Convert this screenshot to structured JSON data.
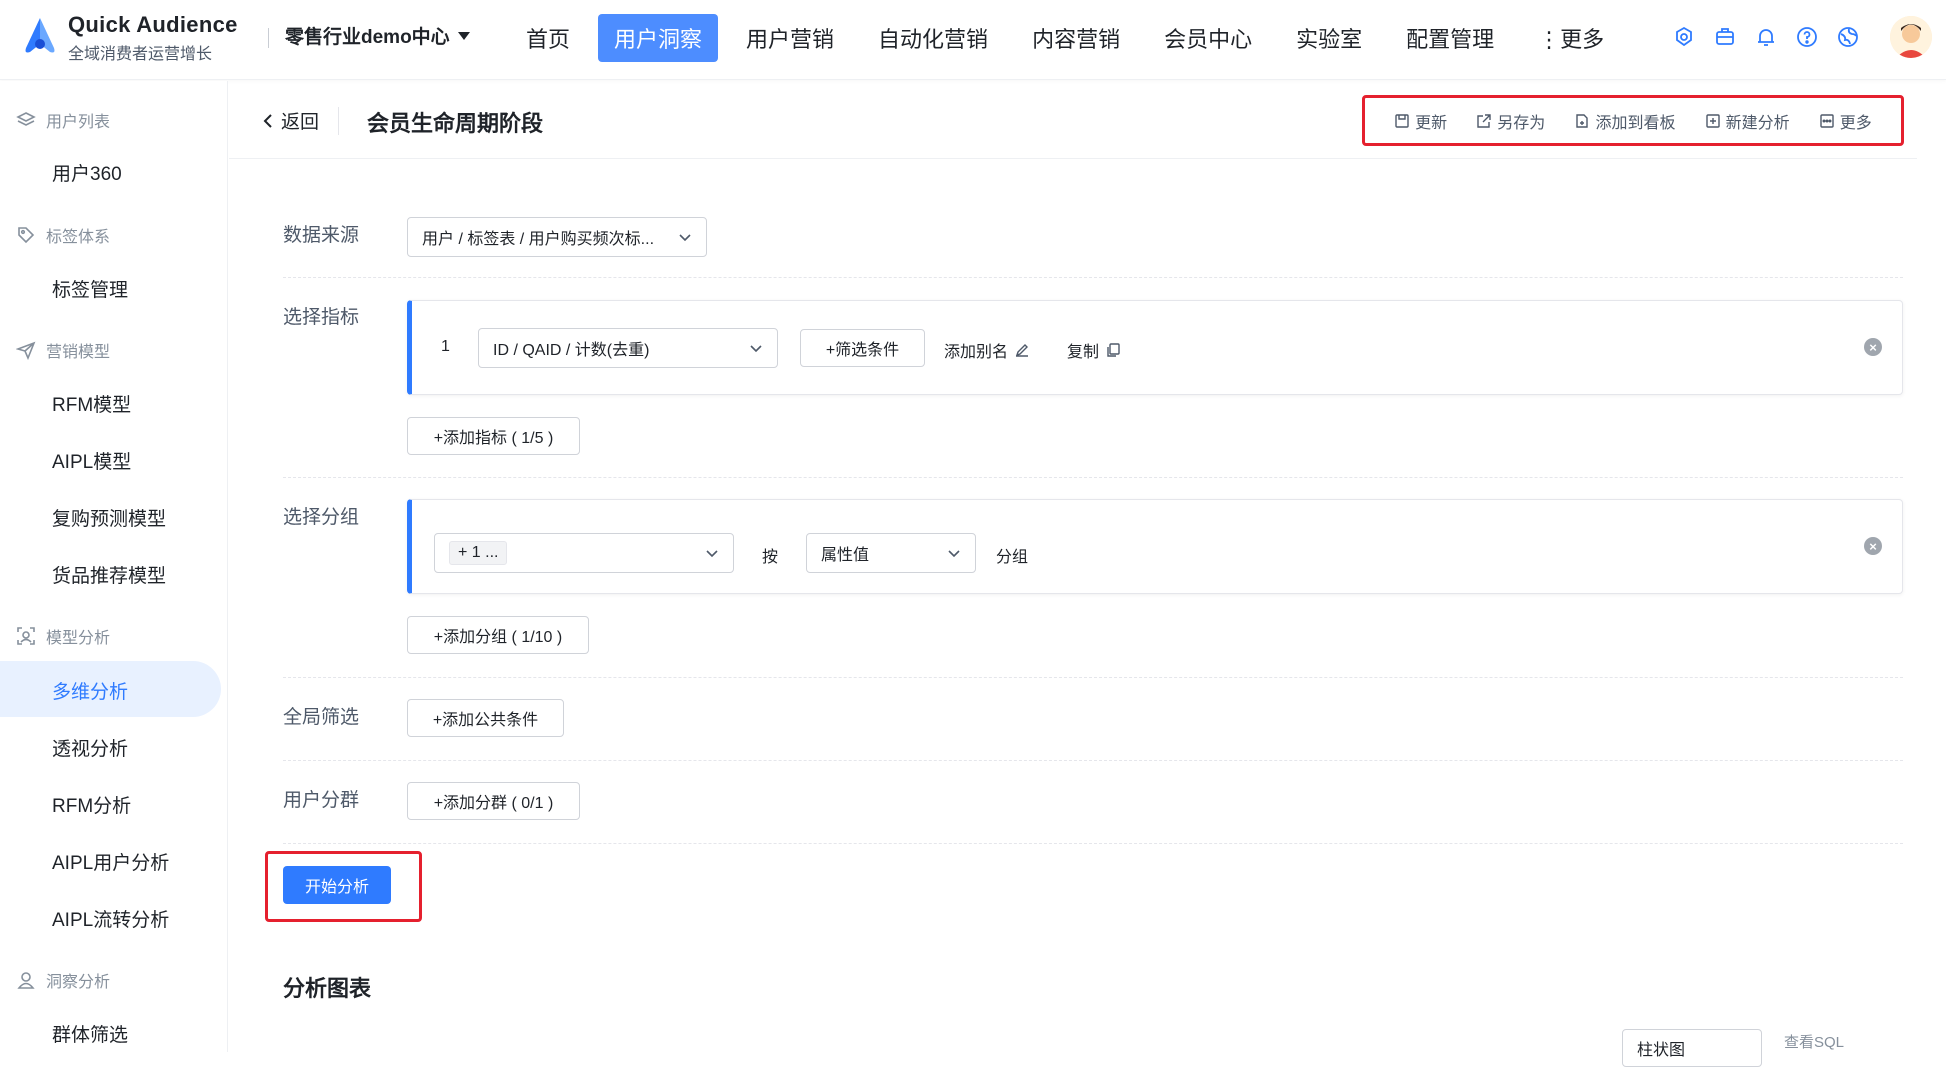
{
  "app": {
    "name": "Quick Audience",
    "subtitle": "全域消费者运营增长",
    "project": "零售行业demo中心"
  },
  "nav": {
    "items": [
      "首页",
      "用户洞察",
      "用户营销",
      "自动化营销",
      "内容营销",
      "会员中心",
      "实验室",
      "配置管理",
      "⋮更多"
    ],
    "active_index": 1
  },
  "top_icons": [
    "settings-icon",
    "briefcase-icon",
    "bell-icon",
    "help-icon",
    "globe-icon",
    "avatar"
  ],
  "sidebar": {
    "groups": [
      {
        "label": "用户列表",
        "icon": "layers-icon",
        "items": [
          "用户360"
        ]
      },
      {
        "label": "标签体系",
        "icon": "tag-icon",
        "items": [
          "标签管理"
        ]
      },
      {
        "label": "营销模型",
        "icon": "send-icon",
        "items": [
          "RFM模型",
          "AIPL模型",
          "复购预测模型",
          "货品推荐模型"
        ]
      },
      {
        "label": "模型分析",
        "icon": "scan-icon",
        "items": [
          "多维分析",
          "透视分析",
          "RFM分析",
          "AIPL用户分析",
          "AIPL流转分析"
        ]
      },
      {
        "label": "洞察分析",
        "icon": "users-icon",
        "items": [
          "群体筛选"
        ]
      }
    ],
    "active_item": "多维分析"
  },
  "header": {
    "back_label": "返回",
    "title": "会员生命周期阶段",
    "actions": [
      "更新",
      "另存为",
      "添加到看板",
      "新建分析",
      "更多"
    ]
  },
  "form": {
    "datasource": {
      "label": "数据来源",
      "value": "用户 / 标签表 / 用户购买频次标..."
    },
    "metrics": {
      "label": "选择指标",
      "rows": [
        {
          "index": "1",
          "value": "ID / QAID / 计数(去重)",
          "filter_label": "+筛选条件",
          "alias_label": "添加别名",
          "copy_label": "复制"
        }
      ],
      "add_label": "+添加指标 ( 1/5 )"
    },
    "groups": {
      "label": "选择分组",
      "chip": "+ 1 ...",
      "by_label": "按",
      "attr_value": "属性值",
      "suffix": "分组",
      "add_label": "+添加分组 ( 1/10 )"
    },
    "global_filter": {
      "label": "全局筛选",
      "add_label": "+添加公共条件"
    },
    "segment": {
      "label": "用户分群",
      "add_label": "+添加分群 ( 0/1 )"
    },
    "start_label": "开始分析"
  },
  "chart_section": {
    "title": "分析图表",
    "chart_type": "柱状图",
    "view_sql": "查看SQL"
  },
  "colors": {
    "primary": "#2f7bff",
    "active_nav": "#4d8dff",
    "highlight": "#e5202e"
  }
}
